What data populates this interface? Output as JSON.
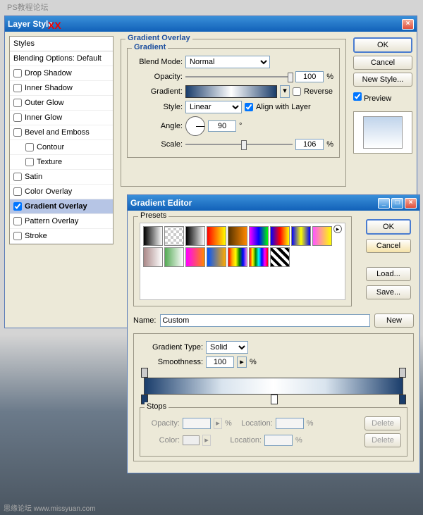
{
  "watermark": "PS教程论坛",
  "footer": "思缘论坛  www.missyuan.com",
  "layerStyle": {
    "title": "Layer Style",
    "stylesHeader": "Styles",
    "blendingOptions": "Blending Options: Default",
    "items": [
      {
        "label": "Drop Shadow",
        "checked": false
      },
      {
        "label": "Inner Shadow",
        "checked": false
      },
      {
        "label": "Outer Glow",
        "checked": false
      },
      {
        "label": "Inner Glow",
        "checked": false
      },
      {
        "label": "Bevel and Emboss",
        "checked": false
      },
      {
        "label": "Contour",
        "checked": false,
        "indent": true
      },
      {
        "label": "Texture",
        "checked": false,
        "indent": true
      },
      {
        "label": "Satin",
        "checked": false
      },
      {
        "label": "Color Overlay",
        "checked": false
      },
      {
        "label": "Gradient Overlay",
        "checked": true,
        "selected": true
      },
      {
        "label": "Pattern Overlay",
        "checked": false
      },
      {
        "label": "Stroke",
        "checked": false
      }
    ],
    "panelTitle": "Gradient Overlay",
    "gradientTitle": "Gradient",
    "blendModeLabel": "Blend Mode:",
    "blendMode": "Normal",
    "opacityLabel": "Opacity:",
    "opacity": "100",
    "gradientLabel": "Gradient:",
    "reverseLabel": "Reverse",
    "styleLabel": "Style:",
    "style": "Linear",
    "alignLabel": "Align with Layer",
    "angleLabel": "Angle:",
    "angle": "90",
    "scaleLabel": "Scale:",
    "scale": "106",
    "ok": "OK",
    "cancel": "Cancel",
    "newStyle": "New Style...",
    "previewLabel": "Preview"
  },
  "gradientEditor": {
    "title": "Gradient Editor",
    "presetsTitle": "Presets",
    "ok": "OK",
    "cancel": "Cancel",
    "load": "Load...",
    "save": "Save...",
    "nameLabel": "Name:",
    "name": "Custom",
    "newBtn": "New",
    "typeLabel": "Gradient Type:",
    "type": "Solid",
    "smoothLabel": "Smoothness:",
    "smooth": "100",
    "stopsTitle": "Stops",
    "opacityLabel": "Opacity:",
    "locationLabel": "Location:",
    "colorLabel": "Color:",
    "delete": "Delete",
    "presets": [
      "linear-gradient(to right,#000,#fff)",
      "repeating-conic-gradient(#ccc 0 25%,#fff 0 50%) 0/8px 8px",
      "linear-gradient(to right,#000,#fff)",
      "linear-gradient(to right,#f00,#ff0)",
      "linear-gradient(to right,#530,#f80)",
      "linear-gradient(to right,#f0f,#00f,#0f0)",
      "linear-gradient(to right,#00f,#f00,#ff0)",
      "linear-gradient(to right,#00f,#ff0,#00f)",
      "linear-gradient(to right,#f5f,#ff0)",
      "linear-gradient(to right,#a88,#fff)",
      "linear-gradient(to right,#5a5,#fff)",
      "linear-gradient(to right,#f0f,#f80)",
      "linear-gradient(to right,#05f,#fa0)",
      "linear-gradient(to right,red,orange,yellow,green,blue,violet)",
      "linear-gradient(to right,red,yellow,green,cyan,blue,magenta,red)",
      "repeating-linear-gradient(45deg,#000 0 4px,#fff 4px 8px)"
    ]
  }
}
